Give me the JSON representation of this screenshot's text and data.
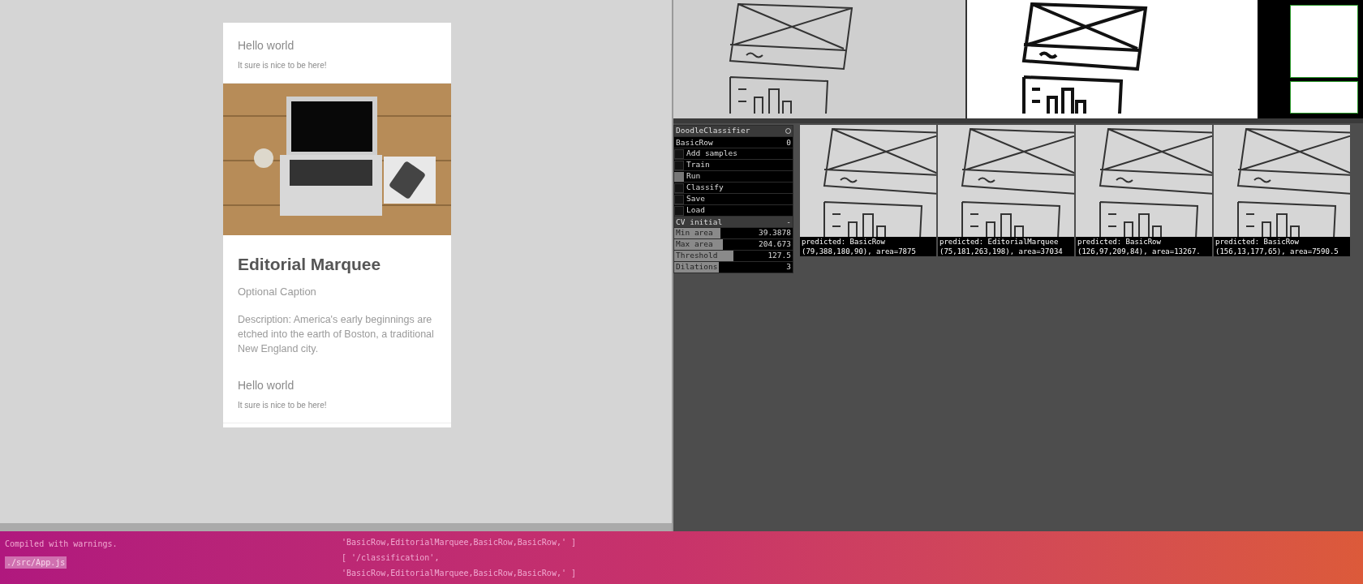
{
  "card": {
    "items": [
      {
        "kind": "row",
        "title": "Hello world",
        "subtitle": "It sure is nice to be here!"
      },
      {
        "kind": "marquee",
        "title": "Editorial Marquee",
        "caption": "Optional Caption",
        "description": "Description: America's early beginnings are etched into the earth of Boston, a traditional New England city."
      },
      {
        "kind": "row",
        "title": "Hello world",
        "subtitle": "It sure is nice to be here!"
      }
    ]
  },
  "classifier": {
    "title": "DoodleClassifier",
    "class_name": "BasicRow",
    "class_index": "0",
    "actions": [
      {
        "label": "Add samples",
        "checked": false
      },
      {
        "label": "Train",
        "checked": false
      },
      {
        "label": "Run",
        "checked": true
      },
      {
        "label": "Classify",
        "checked": false
      },
      {
        "label": "Save",
        "checked": false
      },
      {
        "label": "Load",
        "checked": false
      }
    ],
    "section": {
      "title": "CV initial",
      "expanded": true,
      "toggle": "-"
    },
    "params": [
      {
        "label": "Min area",
        "value": "39.3878",
        "level": 0.39
      },
      {
        "label": "Max area",
        "value": "204.673",
        "level": 0.41
      },
      {
        "label": "Threshold",
        "value": "127.5",
        "level": 0.5
      },
      {
        "label": "Dilations",
        "value": "3",
        "level": 0.38
      }
    ]
  },
  "predictions": [
    {
      "label": "predicted: BasicRow",
      "bounds": "(79,388,180,90), area=7875"
    },
    {
      "label": "predicted: EditorialMarquee",
      "bounds": "(75,181,263,198), area=37034"
    },
    {
      "label": "predicted: BasicRow",
      "bounds": "(126,97,209,84), area=13267."
    },
    {
      "label": "predicted: BasicRow",
      "bounds": "(156,13,177,65), area=7590.5"
    }
  ],
  "terminal": {
    "left": [
      {
        "text": "Compiled with warnings.",
        "highlighted": false
      },
      {
        "text": "./src/App.js",
        "highlighted": true
      }
    ],
    "right": [
      "'BasicRow,EditorialMarquee,BasicRow,BasicRow,' ]",
      "[ '/classification',",
      "'BasicRow,EditorialMarquee,BasicRow,BasicRow,' ]"
    ]
  }
}
